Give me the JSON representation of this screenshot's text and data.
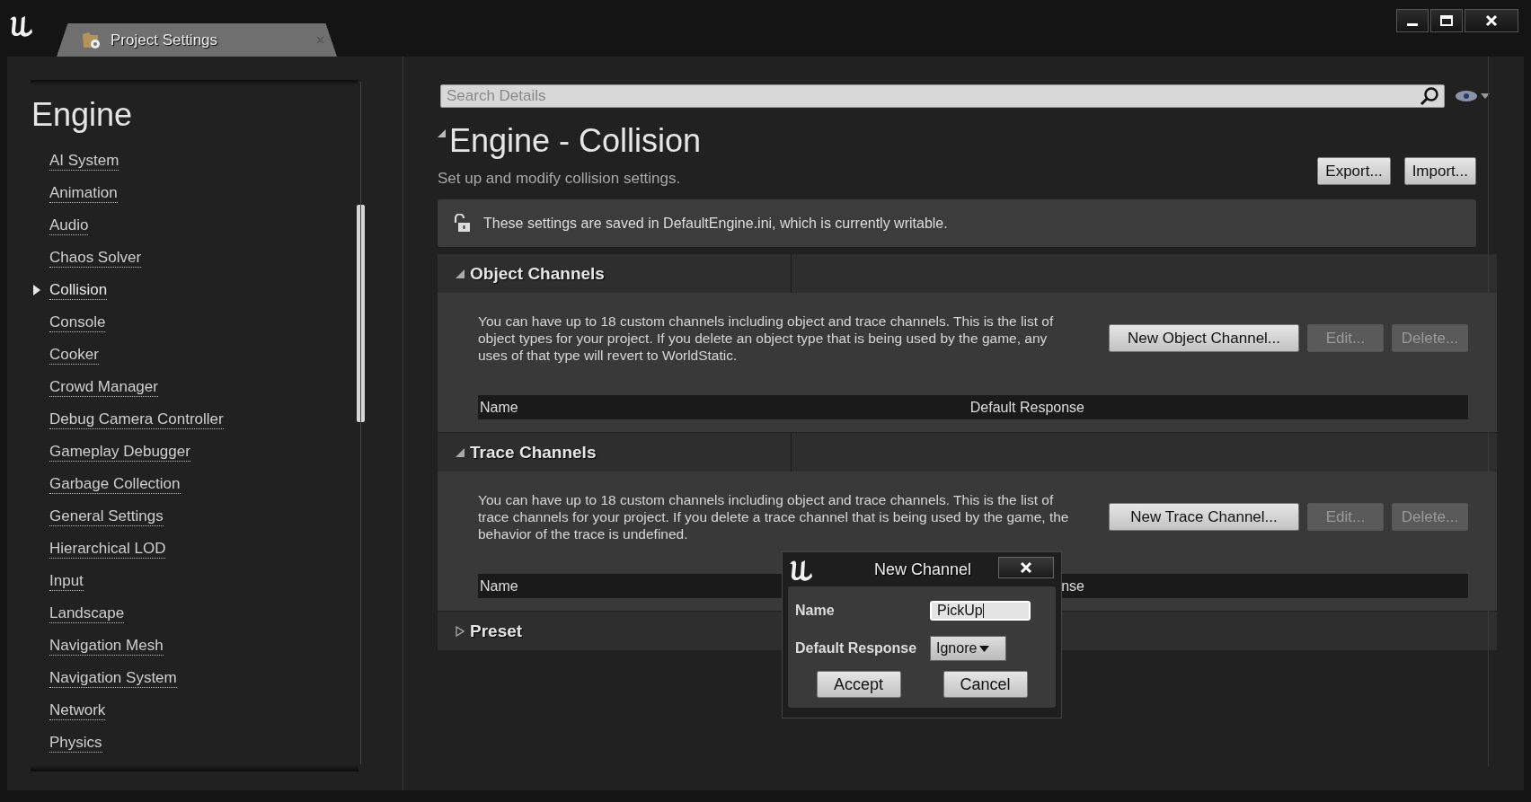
{
  "tab": {
    "title": "Project Settings",
    "selected": true
  },
  "sidebar": {
    "heading": "Engine",
    "items": [
      {
        "label": "AI System",
        "selected": false
      },
      {
        "label": "Animation",
        "selected": false
      },
      {
        "label": "Audio",
        "selected": false
      },
      {
        "label": "Chaos Solver",
        "selected": false
      },
      {
        "label": "Collision",
        "selected": true
      },
      {
        "label": "Console",
        "selected": false
      },
      {
        "label": "Cooker",
        "selected": false
      },
      {
        "label": "Crowd Manager",
        "selected": false
      },
      {
        "label": "Debug Camera Controller",
        "selected": false
      },
      {
        "label": "Gameplay Debugger",
        "selected": false
      },
      {
        "label": "Garbage Collection",
        "selected": false
      },
      {
        "label": "General Settings",
        "selected": false
      },
      {
        "label": "Hierarchical LOD",
        "selected": false
      },
      {
        "label": "Input",
        "selected": false
      },
      {
        "label": "Landscape",
        "selected": false
      },
      {
        "label": "Navigation Mesh",
        "selected": false
      },
      {
        "label": "Navigation System",
        "selected": false
      },
      {
        "label": "Network",
        "selected": false
      },
      {
        "label": "Physics",
        "selected": false
      }
    ]
  },
  "search": {
    "placeholder": "Search Details"
  },
  "page": {
    "title": "Engine - Collision",
    "subtitle": "Set up and modify collision settings.",
    "buttons": [
      "Export...",
      "Import..."
    ],
    "notice": "These settings are saved in DefaultEngine.ini, which is currently writable."
  },
  "sections": [
    {
      "title": "Object Channels",
      "expanded": true,
      "description": "You can have up to 18 custom channels including object and trace channels. This is the list of object types for your project. If you delete an object type that is being used by the game, any uses of that type will revert to WorldStatic.",
      "buttons": [
        {
          "label": "New Object Channel...",
          "disabled": false
        },
        {
          "label": "Edit...",
          "disabled": true
        },
        {
          "label": "Delete...",
          "disabled": true
        }
      ],
      "columns": [
        "Name",
        "Default Response"
      ]
    },
    {
      "title": "Trace Channels",
      "expanded": true,
      "description": "You can have up to 18 custom channels including object and trace channels. This is the list of trace channels for your project. If you delete a trace channel that is being used by the game, the behavior of the trace is undefined.",
      "buttons": [
        {
          "label": "New Trace Channel...",
          "disabled": false
        },
        {
          "label": "Edit...",
          "disabled": true
        },
        {
          "label": "Delete...",
          "disabled": true
        }
      ],
      "columns": [
        "Name",
        "nse"
      ]
    },
    {
      "title": "Preset",
      "expanded": false
    }
  ],
  "dialog": {
    "title": "New Channel",
    "fields": [
      {
        "kind": "text",
        "label": "Name",
        "value": "PickUp"
      },
      {
        "kind": "dropdown",
        "label": "Default Response",
        "value": "Ignore"
      }
    ],
    "buttons": [
      "Accept",
      "Cancel"
    ]
  }
}
